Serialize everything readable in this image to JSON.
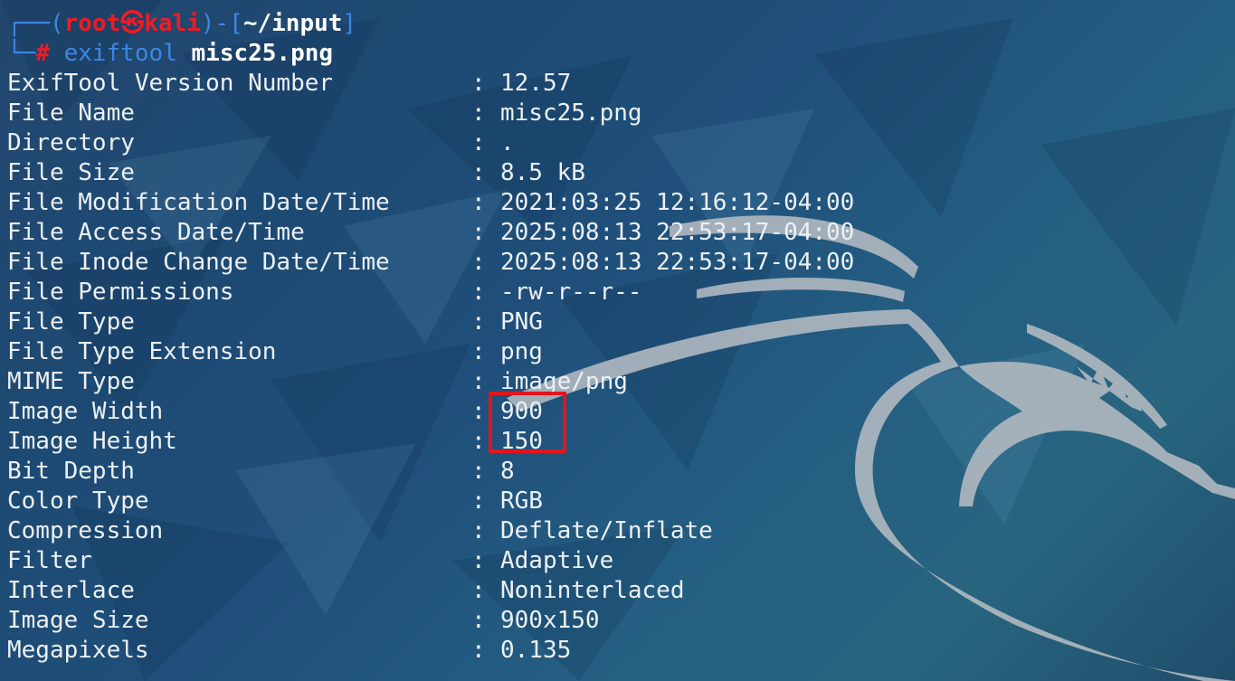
{
  "prompt": {
    "open_bracket": "┌──(",
    "user": "root㉿kali",
    "mid": ")-[",
    "path": "~/input",
    "close": "]",
    "line2_prefix": "└─",
    "hash": "#",
    "command": "exiftool",
    "argument": "misc25.png"
  },
  "rows": [
    {
      "key": "ExifTool Version Number",
      "value": "12.57"
    },
    {
      "key": "File Name",
      "value": "misc25.png"
    },
    {
      "key": "Directory",
      "value": "."
    },
    {
      "key": "File Size",
      "value": "8.5 kB"
    },
    {
      "key": "File Modification Date/Time",
      "value": "2021:03:25 12:16:12-04:00"
    },
    {
      "key": "File Access Date/Time",
      "value": "2025:08:13 22:53:17-04:00"
    },
    {
      "key": "File Inode Change Date/Time",
      "value": "2025:08:13 22:53:17-04:00"
    },
    {
      "key": "File Permissions",
      "value": "-rw-r--r--"
    },
    {
      "key": "File Type",
      "value": "PNG"
    },
    {
      "key": "File Type Extension",
      "value": "png"
    },
    {
      "key": "MIME Type",
      "value": "image/png"
    },
    {
      "key": "Image Width",
      "value": "900"
    },
    {
      "key": "Image Height",
      "value": "150"
    },
    {
      "key": "Bit Depth",
      "value": "8"
    },
    {
      "key": "Color Type",
      "value": "RGB"
    },
    {
      "key": "Compression",
      "value": "Deflate/Inflate"
    },
    {
      "key": "Filter",
      "value": "Adaptive"
    },
    {
      "key": "Interlace",
      "value": "Noninterlaced"
    },
    {
      "key": "Image Size",
      "value": "900x150"
    },
    {
      "key": "Megapixels",
      "value": "0.135"
    }
  ],
  "separator": ":",
  "colors": {
    "prompt_frame": "#3d86e6",
    "prompt_user": "#ee1c24",
    "text": "#ecf0f4",
    "highlight_box": "#e2151d"
  }
}
